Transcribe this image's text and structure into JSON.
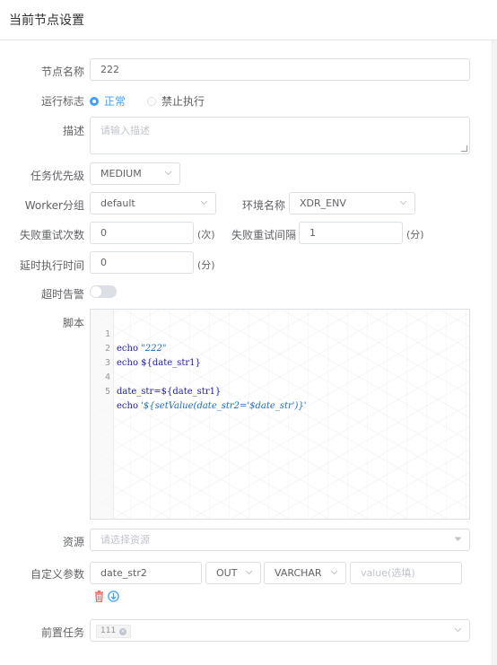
{
  "header": {
    "title": "当前节点设置"
  },
  "form": {
    "node_name": {
      "label": "节点名称",
      "value": "222"
    },
    "run_flag": {
      "label": "运行标志",
      "options": [
        "正常",
        "禁止执行"
      ],
      "selected": "正常"
    },
    "description": {
      "label": "描述",
      "placeholder": "请输入描述"
    },
    "priority": {
      "label": "任务优先级",
      "value": "MEDIUM"
    },
    "worker_group": {
      "label": "Worker分组",
      "value": "default"
    },
    "environment": {
      "label": "环境名称",
      "value": "XDR_ENV"
    },
    "retry_times": {
      "label": "失败重试次数",
      "value": "0",
      "unit": "(次)"
    },
    "retry_interval": {
      "label": "失败重试间隔",
      "value": "1",
      "unit": "(分)"
    },
    "delay_time": {
      "label": "延时执行时间",
      "value": "0",
      "unit": "(分)"
    },
    "timeout_alarm": {
      "label": "超时告警",
      "enabled": false
    },
    "script": {
      "label": "脚本",
      "lines": [
        {
          "num": "1",
          "kw": "echo ",
          "str": "\"222\""
        },
        {
          "num": "2",
          "kw": "echo ${date_str1}",
          "str": ""
        },
        {
          "num": "3",
          "kw": "",
          "str": ""
        },
        {
          "num": "4",
          "kw": "date_str=${date_str1}",
          "str": ""
        },
        {
          "num": "5",
          "kw": "echo ",
          "str": "'${setValue(date_str2='$date_str')}'"
        }
      ]
    },
    "resources": {
      "label": "资源",
      "placeholder": "请选择资源"
    },
    "custom_params": {
      "label": "自定义参数",
      "prop": "date_str2",
      "direct": "OUT",
      "type": "VARCHAR",
      "value_placeholder": "value(选填)"
    },
    "pre_tasks": {
      "label": "前置任务",
      "tags": [
        "111"
      ]
    }
  }
}
